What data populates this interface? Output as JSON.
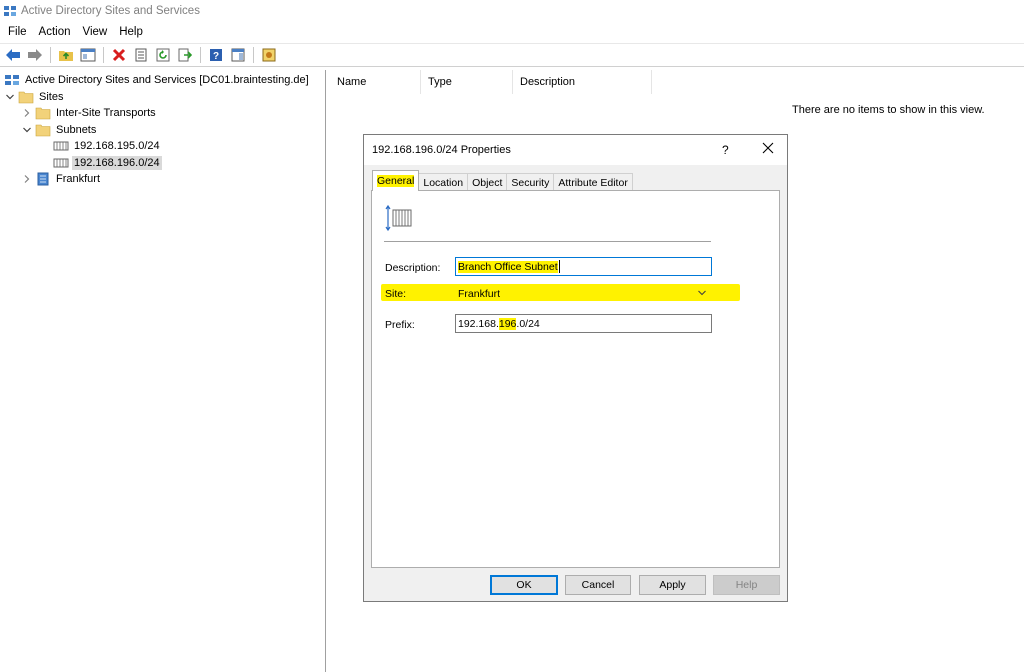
{
  "window": {
    "title": "Active Directory Sites and Services"
  },
  "menu": [
    "File",
    "Action",
    "View",
    "Help"
  ],
  "tree": {
    "root": "Active Directory Sites and Services [DC01.braintesting.de]",
    "sites": "Sites",
    "inter_site": "Inter-Site Transports",
    "subnets": "Subnets",
    "subnet1": "192.168.195.0/24",
    "subnet2": "192.168.196.0/24",
    "frankfurt": "Frankfurt"
  },
  "list": {
    "columns": [
      "Name",
      "Type",
      "Description"
    ],
    "empty_message": "There are no items to show in this view."
  },
  "dialog": {
    "title": "192.168.196.0/24 Properties",
    "help": "?",
    "tabs": [
      "General",
      "Location",
      "Object",
      "Security",
      "Attribute Editor"
    ],
    "labels": {
      "description": "Description:",
      "site": "Site:",
      "prefix": "Prefix:"
    },
    "values": {
      "description": "Branch Office Subnet",
      "site": "Frankfurt",
      "prefix_a": "192.168.",
      "prefix_b": "196",
      "prefix_c": ".0/24"
    },
    "buttons": {
      "ok": "OK",
      "cancel": "Cancel",
      "apply": "Apply",
      "help": "Help"
    }
  },
  "colors": {
    "highlight": "#fff200",
    "accent": "#0078d7"
  }
}
